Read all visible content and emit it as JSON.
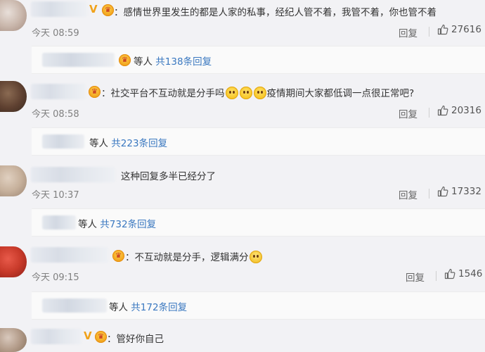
{
  "comments": [
    {
      "text": "感情世界里发生的都是人家的私事，经纪人管不着，我管不着，你也管不着",
      "time": "今天 08:59",
      "reply_label": "回复",
      "likes": "27616",
      "sub_prefix": "等人",
      "sub_link": "共138条回复"
    },
    {
      "text_a": "社交平台不互动就是分手吗",
      "text_b": "疫情期间大家都低调一点很正常吧?",
      "time": "今天 08:58",
      "reply_label": "回复",
      "likes": "20316",
      "sub_prefix": "等人",
      "sub_link": "共223条回复"
    },
    {
      "text": "这种回复多半已经分了",
      "time": "今天 10:37",
      "reply_label": "回复",
      "likes": "17332",
      "sub_prefix": "等人",
      "sub_link": "共732条回复"
    },
    {
      "text": "不互动就是分手，逻辑满分",
      "time": "今天 09:15",
      "reply_label": "回复",
      "likes": "1546",
      "sub_prefix": "等人",
      "sub_link": "共172条回复"
    },
    {
      "text": "管好你自己"
    }
  ],
  "icons": {
    "like": "thumbs-up-icon",
    "badge": "member-badge-icon",
    "verified": "verified-v-icon"
  },
  "colors": {
    "link": "#3a78c0",
    "badge": "#f0a21a"
  }
}
